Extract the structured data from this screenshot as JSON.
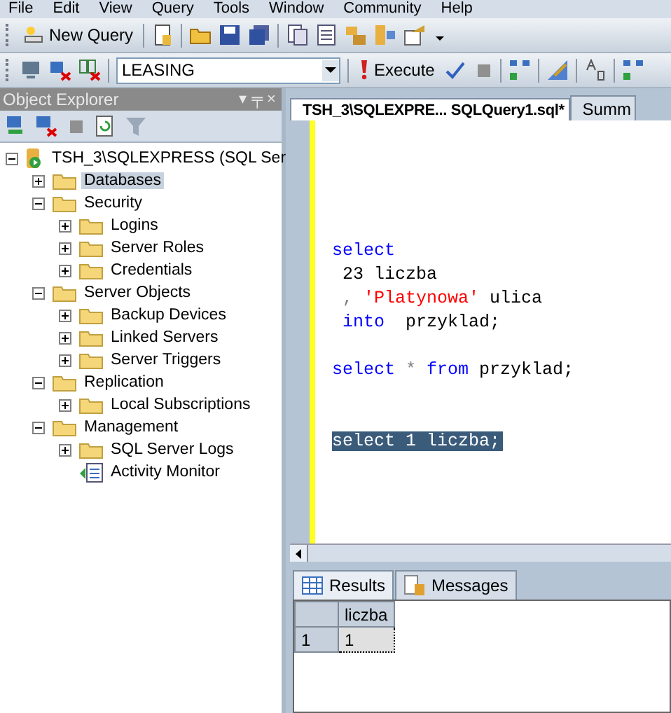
{
  "menu": [
    "File",
    "Edit",
    "View",
    "Query",
    "Tools",
    "Window",
    "Community",
    "Help"
  ],
  "toolbar1": {
    "new_query": "New Query"
  },
  "toolbar2": {
    "database": "LEASING",
    "execute": "Execute"
  },
  "object_explorer": {
    "title": "Object Explorer",
    "pin": "▾ ╤ ×",
    "tree": [
      {
        "label": "TSH_3\\SQLEXPRESS (SQL Ser",
        "kind": "server",
        "expanded": true,
        "selected": false,
        "children": [
          {
            "label": "Databases",
            "kind": "folder",
            "expanded": false,
            "selected": true
          },
          {
            "label": "Security",
            "kind": "folder",
            "expanded": true,
            "selected": false,
            "children": [
              {
                "label": "Logins",
                "kind": "folder",
                "expanded": false,
                "selected": false
              },
              {
                "label": "Server Roles",
                "kind": "folder",
                "expanded": false,
                "selected": false
              },
              {
                "label": "Credentials",
                "kind": "folder",
                "expanded": false,
                "selected": false
              }
            ]
          },
          {
            "label": "Server Objects",
            "kind": "folder",
            "expanded": true,
            "selected": false,
            "children": [
              {
                "label": "Backup Devices",
                "kind": "folder",
                "expanded": false,
                "selected": false
              },
              {
                "label": "Linked Servers",
                "kind": "folder",
                "expanded": false,
                "selected": false
              },
              {
                "label": "Server Triggers",
                "kind": "folder",
                "expanded": false,
                "selected": false
              }
            ]
          },
          {
            "label": "Replication",
            "kind": "folder",
            "expanded": true,
            "selected": false,
            "children": [
              {
                "label": "Local Subscriptions",
                "kind": "folder",
                "expanded": false,
                "selected": false
              }
            ]
          },
          {
            "label": "Management",
            "kind": "folder",
            "expanded": true,
            "selected": false,
            "children": [
              {
                "label": "SQL Server Logs",
                "kind": "folder",
                "expanded": false,
                "selected": false
              },
              {
                "label": "Activity Monitor",
                "kind": "monitor",
                "selected": false
              }
            ]
          }
        ]
      }
    ]
  },
  "editor_tabs": [
    {
      "label": "TSH_3\\SQLEXPRE... SQLQuery1.sql*",
      "selected": true
    },
    {
      "label": "Summ",
      "selected": false
    }
  ],
  "code": [
    {
      "kind": "blank"
    },
    {
      "kind": "blank"
    },
    {
      "kind": "blank"
    },
    {
      "kind": "blank"
    },
    {
      "kind": "blank"
    },
    {
      "kind": "code",
      "selected": false,
      "tokens": [
        {
          "text": "select",
          "kind": "keyword"
        }
      ]
    },
    {
      "kind": "code",
      "selected": false,
      "tokens": [
        {
          "text": " 23 liczba",
          "kind": "plain"
        }
      ]
    },
    {
      "kind": "code",
      "selected": false,
      "tokens": [
        {
          "text": " , ",
          "kind": "operator"
        },
        {
          "text": "'Platynowa'",
          "kind": "string"
        },
        {
          "text": " ulica",
          "kind": "plain"
        }
      ]
    },
    {
      "kind": "code",
      "selected": false,
      "tokens": [
        {
          "text": " into",
          "kind": "keyword"
        },
        {
          "text": "  przyklad;",
          "kind": "plain"
        }
      ]
    },
    {
      "kind": "blank"
    },
    {
      "kind": "code",
      "selected": false,
      "tokens": [
        {
          "text": "select",
          "kind": "keyword"
        },
        {
          "text": " * ",
          "kind": "operator"
        },
        {
          "text": "from",
          "kind": "keyword"
        },
        {
          "text": " przyklad;",
          "kind": "plain"
        }
      ]
    },
    {
      "kind": "blank"
    },
    {
      "kind": "blank"
    },
    {
      "kind": "code",
      "selected": true,
      "tokens": [
        {
          "text": "select 1 liczba;"
        }
      ]
    }
  ],
  "result_tabs": [
    {
      "label": "Results",
      "kind": "grid",
      "selected": true
    },
    {
      "label": "Messages",
      "kind": "messages",
      "selected": false
    }
  ],
  "grid": {
    "columns": [
      "liczba"
    ],
    "rows": [
      {
        "number": "1",
        "cells": [
          "1"
        ]
      }
    ]
  }
}
